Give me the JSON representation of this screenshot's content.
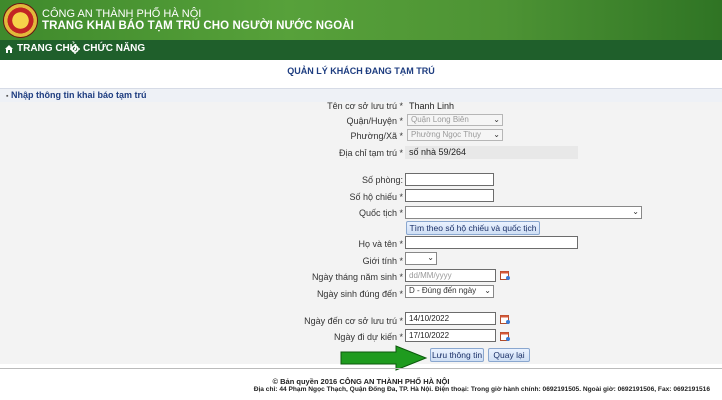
{
  "header": {
    "org_name": "CÔNG AN THÀNH PHỐ HÀ NỘI",
    "site_title": "TRANG KHAI BÁO TẠM TRÚ CHO NGƯỜI NƯỚC NGOÀI",
    "logo_icon": "police-emblem-icon"
  },
  "nav": {
    "home_label": "TRANG CHỦ",
    "functions_label": "CHỨC NĂNG",
    "home_icon": "home-icon",
    "functions_icon": "gear-icon"
  },
  "page_heading": "QUẢN LÝ KHÁCH ĐANG TẠM TRÚ",
  "section_title": "Nhập thông tin khai báo tạm trú",
  "form": {
    "accommodation_name_label": "Tên cơ sở lưu trú *",
    "accommodation_name_value": "Thanh Linh",
    "district_label": "Quận/Huyện *",
    "district_value": "Quận Long Biên",
    "ward_label": "Phường/Xã *",
    "ward_value": "Phường Ngọc Thụy",
    "address_label": "Địa chỉ tạm trú *",
    "address_value": "số nhà 59/264",
    "room_label": "Số phòng:",
    "room_value": "",
    "passport_label": "Số hộ chiếu *",
    "passport_value": "",
    "nationality_label": "Quốc tịch *",
    "nationality_value": "",
    "search_button": "Tìm theo số hộ chiếu và quốc tịch",
    "fullname_label": "Họ và tên *",
    "fullname_value": "",
    "gender_label": "Giới tính *",
    "gender_value": "",
    "dob_label": "Ngày tháng năm sinh *",
    "dob_placeholder": "dd/MM/yyyy",
    "dob_accuracy_label": "Ngày sinh đúng đến *",
    "dob_accuracy_value": "D - Đúng đến ngày",
    "arrival_label": "Ngày đến cơ sở lưu trú *",
    "arrival_value": "14/10/2022",
    "departure_label": "Ngày đi dự kiến *",
    "departure_value": "17/10/2022",
    "save_button": "Lưu thông tin",
    "back_button": "Quay lại"
  },
  "footer": {
    "copyright": "© Bản quyền 2016 CÔNG AN THÀNH PHỐ HÀ NỘI",
    "address": "Địa chỉ: 44 Phạm Ngọc Thạch, Quận Đống Đa, TP. Hà Nội. Điện thoại: Trong giờ hành chính: 0692191505. Ngoài giờ: 0692191506, Fax: 0692191516"
  },
  "colors": {
    "header_green": "#4d9334",
    "navbar_green": "#1f5f2b",
    "heading_blue": "#1e3d80",
    "arrow_green": "#1f9b1f"
  }
}
